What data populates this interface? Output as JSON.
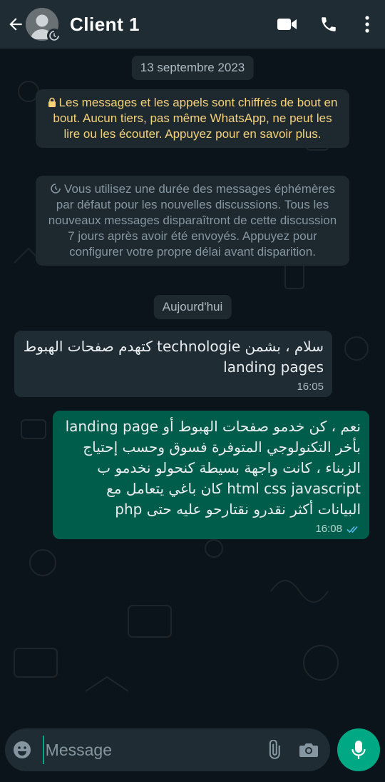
{
  "header": {
    "contact_name": "Client 1",
    "icons": [
      "back-arrow-icon",
      "avatar",
      "video-call-icon",
      "phone-icon",
      "more-icon"
    ]
  },
  "chat": {
    "date_pill": "13 septembre 2023",
    "encryption_notice": "Les messages et les appels sont chiffrés de bout en bout. Aucun tiers, pas même WhatsApp, ne peut les lire ou les écouter. Appuyez pour en savoir plus.",
    "ephemeral_notice": "Vous utilisez une durée des messages éphémères par défaut pour les nouvelles discussions. Tous les nouveaux messages disparaîtront de cette discussion 7 jours après avoir été envoyés. Appuyez pour configurer votre propre délai avant disparition.",
    "today_pill": "Aujourd'hui",
    "messages": [
      {
        "direction": "incoming",
        "text": "سلام ، بشمن technologie كتهدم صفحات الهبوط landing pages",
        "time": "16:05"
      },
      {
        "direction": "outgoing",
        "text": "نعم ، كن خدمو صفحات الهبوط أو landing page بأخر التكنولوجي المتوفرة فسوق وحسب إحتياج الزبناء ، كانت واجهة بسيطة كنحولو نخدمو ب html css javascript كان باغي يتعامل مع البيانات أكثر نقدرو نقتارحو عليه حتى php",
        "time": "16:08",
        "status": "read"
      }
    ]
  },
  "composer": {
    "placeholder": "Message",
    "value": ""
  },
  "colors": {
    "header_bg": "#1f2c34",
    "chat_bg": "#0b141a",
    "outgoing_bubble": "#005c4b",
    "incoming_bubble": "#1f2c34",
    "accent": "#00a884",
    "read_ticks": "#53bdeb",
    "notice_yellow": "#f5d27a"
  }
}
